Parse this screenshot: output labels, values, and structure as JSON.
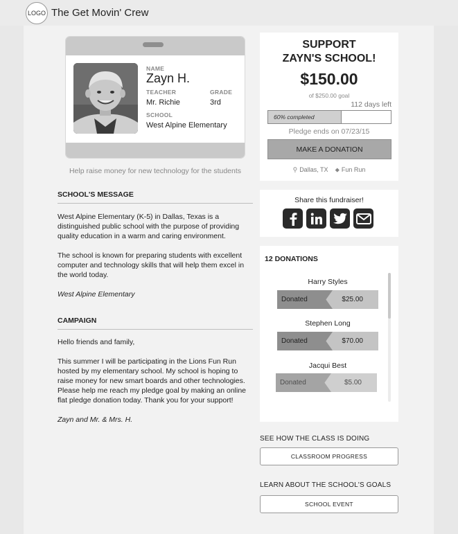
{
  "header": {
    "logo_text": "LOGO",
    "site_name": "The Get Movin' Crew"
  },
  "student": {
    "name_label": "NAME",
    "name": "Zayn H.",
    "teacher_label": "TEACHER",
    "teacher": "Mr. Richie",
    "grade_label": "GRADE",
    "grade": "3rd",
    "school_label": "SCHOOL",
    "school": "West Alpine Elementary",
    "caption": "Help raise money for new technology for the students"
  },
  "school_message": {
    "title": "SCHOOL'S MESSAGE",
    "paragraphs": [
      "West Alpine Elementary (K-5) in Dallas, Texas is a distinguished public school with the purpose of providing quality education in a warm and caring environment.",
      "The school is known for preparing students with excellent computer and technology skills that will help them excel in the world today."
    ],
    "signature": "West Alpine Elementary"
  },
  "campaign": {
    "title": "CAMPAIGN",
    "greeting": "Hello friends and family,",
    "body": "This summer I will be participating in the Lions Fun Run hosted by my elementary school.  My school is hoping to raise money for new smart boards and other technologies. Please help me reach my pledge goal by making an online flat pledge donation today. Thank you for your support!",
    "signature": "Zayn and Mr. & Mrs. H."
  },
  "support": {
    "title_line1": "SUPPORT",
    "title_line2": "ZAYN'S SCHOOL!",
    "amount": "$150.00",
    "goal": "of $250.00 goal",
    "days_left": "112 days left",
    "progress_text": "60% completed",
    "progress_fraction": 0.6,
    "pledge_end": "Pledge ends on 07/23/15",
    "donate_button": "MAKE A DONATION",
    "location": "Dallas, TX",
    "event": "Fun Run"
  },
  "share": {
    "title": "Share this fundraiser!",
    "buttons": [
      "facebook-icon",
      "linkedin-icon",
      "twitter-icon",
      "email-icon"
    ]
  },
  "donations": {
    "title": "12 DONATIONS",
    "items": [
      {
        "name": "Harry Styles",
        "label": "Donated",
        "amount": "$25.00"
      },
      {
        "name": "Stephen Long",
        "label": "Donated",
        "amount": "$70.00"
      },
      {
        "name": "Jacqui Best",
        "label": "Donated",
        "amount": "$5.00"
      }
    ]
  },
  "class_section": {
    "heading": "SEE HOW THE CLASS IS DOING",
    "button": "CLASSROOM PROGRESS"
  },
  "goals_section": {
    "heading": "LEARN ABOUT THE SCHOOL'S GOALS",
    "button": "SCHOOL EVENT"
  }
}
